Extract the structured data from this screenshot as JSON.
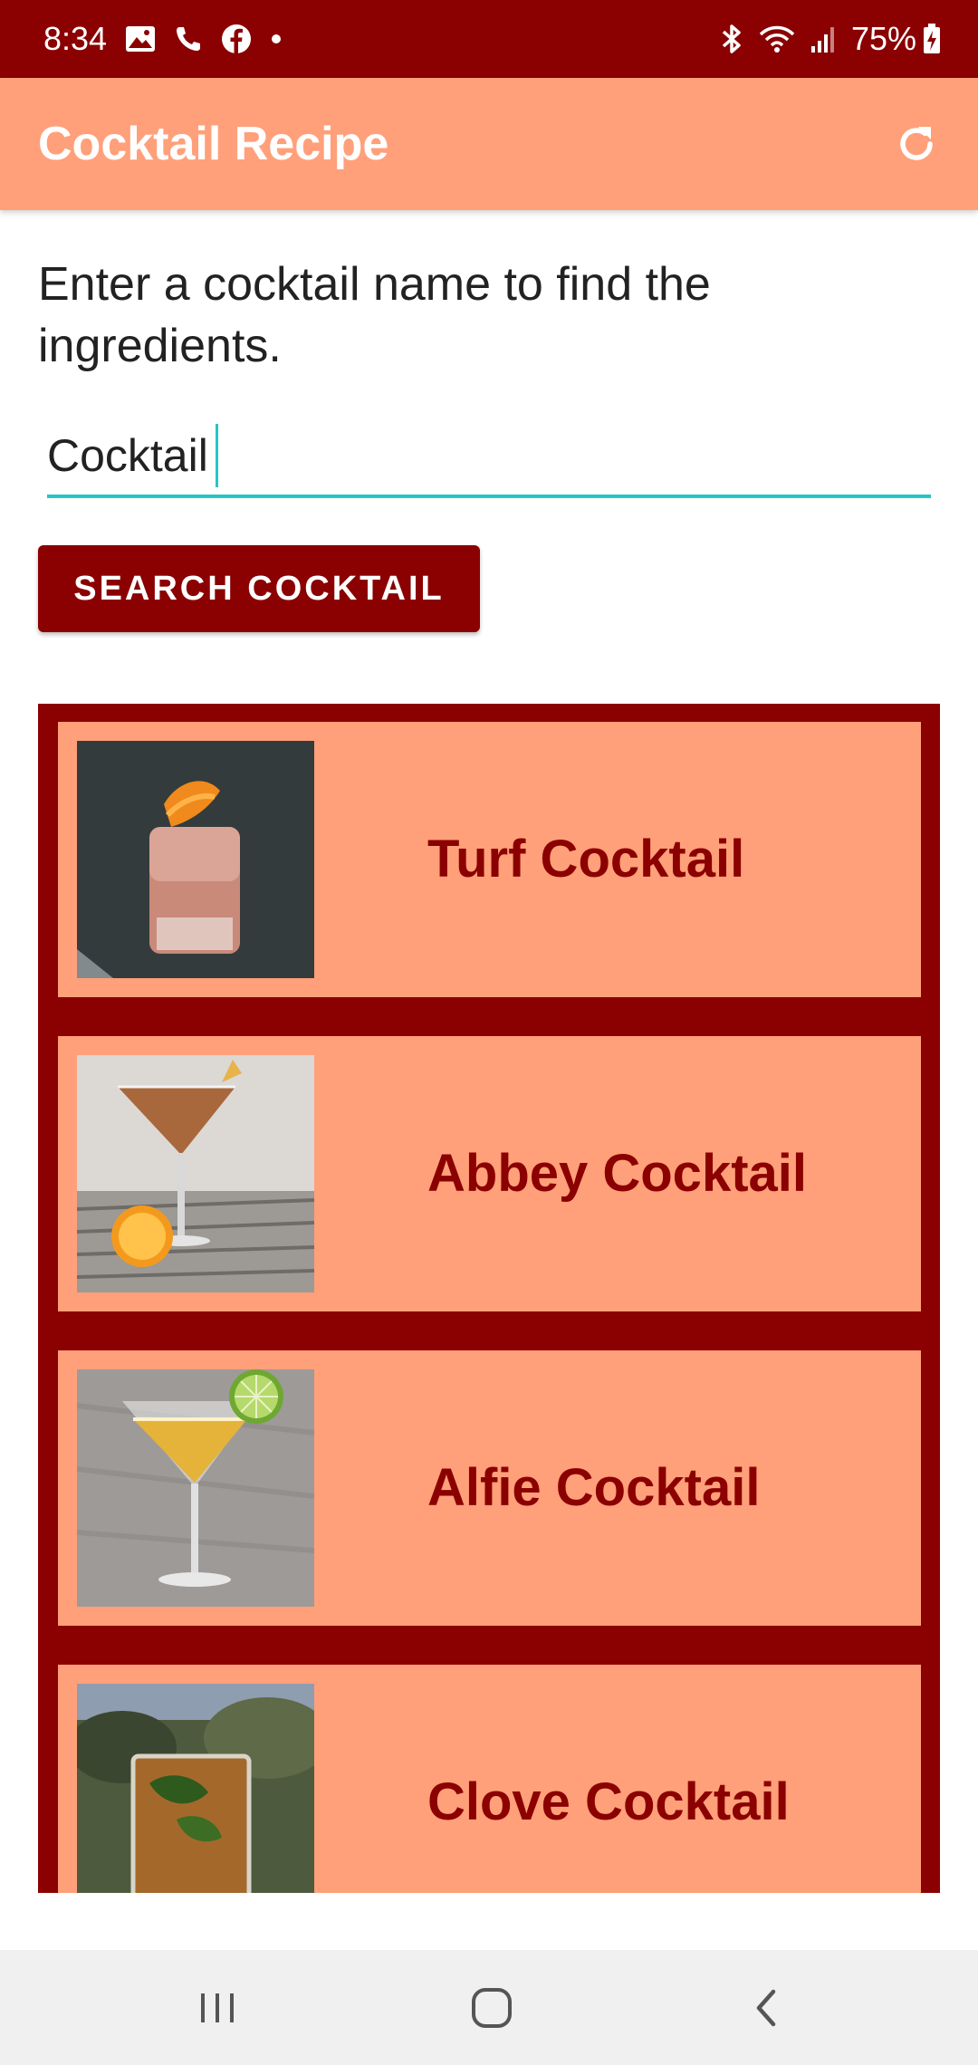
{
  "status_bar": {
    "time": "8:34",
    "battery": "75%",
    "left_icons": [
      "gallery-icon",
      "phone-call-icon",
      "facebook-icon",
      "dot-icon"
    ],
    "right_icons": [
      "bluetooth-icon",
      "wifi-icon",
      "signal-icon",
      "battery-charging-icon"
    ]
  },
  "app_bar": {
    "title": "Cocktail Recipe",
    "action_icon": "refresh-icon"
  },
  "search": {
    "prompt": "Enter a cocktail name to find the ingredients.",
    "value": "Cocktail",
    "button_label": "SEARCH COCKTAIL"
  },
  "results": [
    {
      "name": "Turf Cocktail"
    },
    {
      "name": "Abbey Cocktail"
    },
    {
      "name": "Alfie Cocktail"
    },
    {
      "name": "Clove Cocktail"
    }
  ],
  "nav_bar": {
    "buttons": [
      "recent-apps-icon",
      "home-icon",
      "back-icon"
    ]
  },
  "colors": {
    "primary_dark": "#8b0000",
    "primary": "#ffa07a",
    "accent": "#26c6c6",
    "text_on_primary": "#ffffff"
  }
}
